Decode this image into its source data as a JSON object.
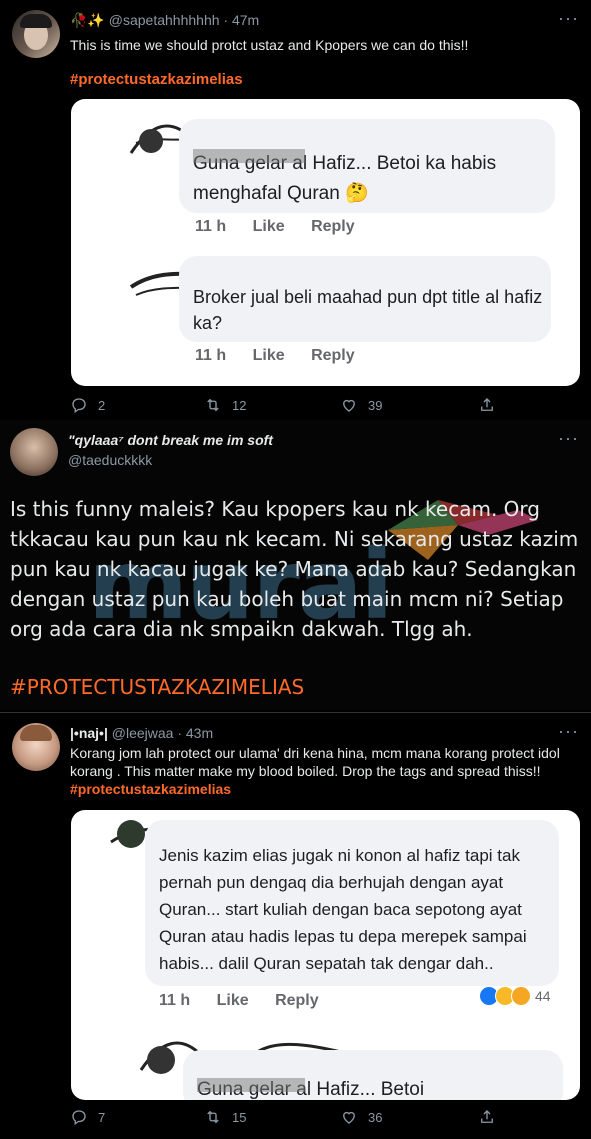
{
  "tweet1": {
    "emoji": "🥀✨",
    "handle": "@sapetahhhhhhh",
    "time": "· 47m",
    "text": "This is time we should protct ustaz and Kpopers we can do this!!",
    "hashtag": "#protectustazkazimelias",
    "comments": [
      {
        "text": "Guna gelar al Hafiz... Betoi ka habis menghafal Quran 🤔",
        "time": "11 h",
        "like": "Like",
        "reply": "Reply"
      },
      {
        "text": "Broker jual beli maahad pun dpt title al hafiz ka?",
        "time": "11 h",
        "like": "Like",
        "reply": "Reply"
      }
    ],
    "replies": "2",
    "retweets": "12",
    "likes": "39"
  },
  "tweet2": {
    "display_name": "\"qylaaa⁷ dont break me im soft",
    "handle": "@taeduckkkk",
    "text": "Is this funny maleis? Kau kpopers kau nk kecam. Org tkkacau kau pun kau nk kecam. Ni sekarang ustaz kazim pun kau nk kacau jugak ke? Mana adab kau? Sedangkan dengan ustaz pun kau boleh buat main mcm ni? Setiap org ada cara dia nk smpaikn dakwah. Tlgg ah.",
    "hashtag": "#PROTECTUSTAZKAZIMELIAS",
    "watermark": "murai"
  },
  "tweet3": {
    "display_name": "|•naj•|",
    "handle": "@leejwaa",
    "time": "· 43m",
    "text": "Korang jom lah protect our ulama' dri kena hina, mcm mana korang protect idol korang . This matter make my  blood boiled. Drop the tags and spread thiss!!",
    "hashtag": "#protectustazkazimelias",
    "comments": [
      {
        "text": "Jenis kazim elias jugak ni konon al hafiz tapi tak pernah pun dengaq dia berhujah dengan ayat Quran... start kuliah dengan baca sepotong ayat Quran atau hadis lepas tu depa merepek sampai habis... dalil Quran sepatah tak dengar dah..",
        "time": "11 h",
        "like": "Like",
        "reply": "Reply",
        "reactions": "44"
      },
      {
        "text": "Guna gelar al Hafiz... Betoi"
      }
    ],
    "replies": "7",
    "retweets": "15",
    "likes": "36"
  },
  "colors": {
    "hashtag": "#ff6a2b",
    "background": "#000000",
    "card": "#ffffff",
    "bubble": "#f0f2f5"
  }
}
